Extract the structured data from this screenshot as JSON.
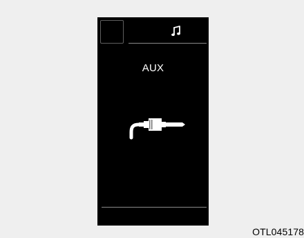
{
  "display": {
    "music_icon": "music-note-icon",
    "source_label": "AUX",
    "cable_icon": "aux-cable-icon"
  },
  "caption": {
    "code": "OTL045178"
  },
  "colors": {
    "background": "#efefef",
    "screen": "#000000",
    "foreground": "#ffffff"
  }
}
